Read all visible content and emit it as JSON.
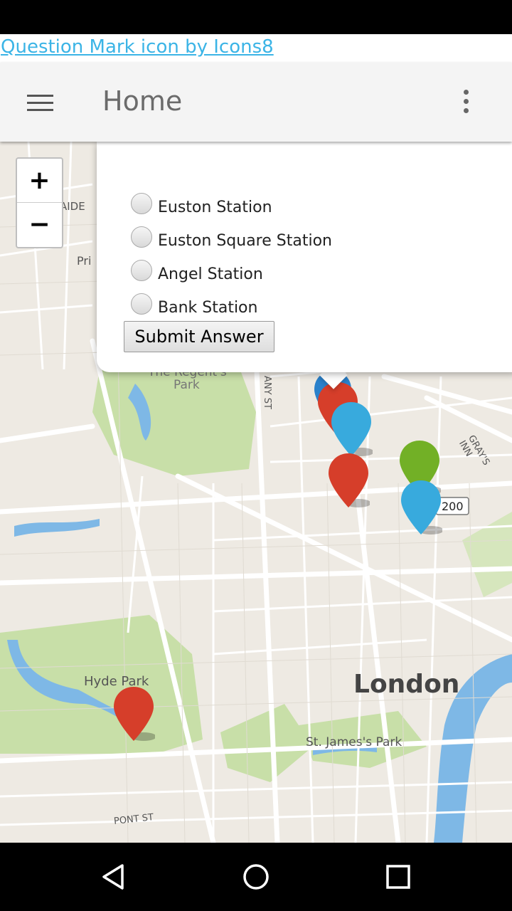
{
  "attribution": {
    "link_text": "Question Mark icon by Icons8"
  },
  "appbar": {
    "title": "Home",
    "menu_icon": "hamburger-menu-icon",
    "overflow_icon": "more-vert-icon"
  },
  "map": {
    "labels": {
      "hyde_park": "Hyde Park",
      "london": "London",
      "st_james_park": "St. James's Park",
      "regents_park_1": "The Regent's",
      "regents_park_2": "Park",
      "pont_st": "PONT ST",
      "road_200": "200",
      "grays_inn": "GRAY'S INN",
      "prim": "Pri",
      "adelaide": "AIDE",
      "street_vert": "ANY ST"
    },
    "zoom": {
      "in_label": "+",
      "out_label": "−"
    }
  },
  "quiz": {
    "options": [
      "Euston Station",
      "Euston Square Station",
      "Angel Station",
      "Bank Station"
    ],
    "submit_label": "Submit Answer"
  },
  "markers": [
    {
      "color": "#d63e2a"
    },
    {
      "color": "#38aadd"
    },
    {
      "color": "#d63e2a"
    },
    {
      "color": "#72b026"
    },
    {
      "color": "#38aadd"
    },
    {
      "color": "#d63e2a"
    },
    {
      "color": "#2a81cb"
    }
  ],
  "colors": {
    "park": "#c8dfa8",
    "water": "#7eb8e6",
    "road": "#ffffff"
  }
}
